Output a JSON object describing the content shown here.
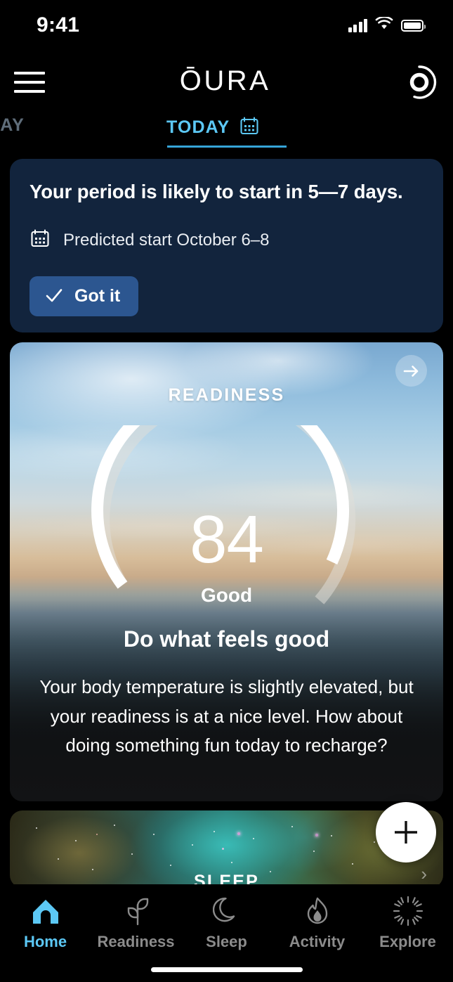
{
  "status_bar": {
    "time": "9:41",
    "signal_icon": "cellular-bars-icon",
    "wifi_icon": "wifi-icon",
    "battery_icon": "battery-icon"
  },
  "header": {
    "menu_icon": "hamburger-menu-icon",
    "brand": "ŌURA",
    "ring_icon": "oura-ring-icon"
  },
  "day_tabs": {
    "yesterday": "RDAY",
    "today": "TODAY",
    "today_icon": "calendar-icon",
    "active": "TODAY",
    "accent_color": "#5cc8f5",
    "underline_color": "#36a4d8"
  },
  "period_card": {
    "title": "Your period is likely to start in 5—7 days.",
    "calendar_icon": "calendar-icon",
    "predicted": "Predicted start October 6–8",
    "button_label": "Got it",
    "button_icon": "check-icon",
    "bg_color": "#12243d",
    "button_color": "#2c5690"
  },
  "readiness_card": {
    "label": "READINESS",
    "score": "84",
    "score_max": 100,
    "state": "Good",
    "insight_title": "Do what feels good",
    "insight_body": "Your body temperature is slightly elevated, but your readiness is at a nice level. How about doing something fun today to recharge?",
    "arrow_icon": "arrow-right-icon",
    "arc_color": "#ffffff",
    "arc_track_color": "rgba(220,220,220,0.45)"
  },
  "sleep_card": {
    "label": "SLEEP",
    "arrow_icon": "arrow-right-icon"
  },
  "fab": {
    "icon": "plus-icon"
  },
  "bottom_nav": {
    "items": [
      {
        "label": "Home",
        "icon": "home-icon",
        "active": true
      },
      {
        "label": "Readiness",
        "icon": "sprout-icon",
        "active": false
      },
      {
        "label": "Sleep",
        "icon": "moon-icon",
        "active": false
      },
      {
        "label": "Activity",
        "icon": "flame-icon",
        "active": false
      },
      {
        "label": "Explore",
        "icon": "sunburst-icon",
        "active": false
      }
    ],
    "active_color": "#5cc8f5",
    "inactive_color": "#8b8b8b"
  },
  "chart_data": {
    "type": "gauge",
    "title": "READINESS",
    "value": 84,
    "range": [
      0,
      100
    ],
    "state_label": "Good",
    "arc_start_deg": 215,
    "arc_sweep_deg": 290,
    "filled_color": "#ffffff",
    "track_color": "rgba(220,220,220,0.45)"
  }
}
